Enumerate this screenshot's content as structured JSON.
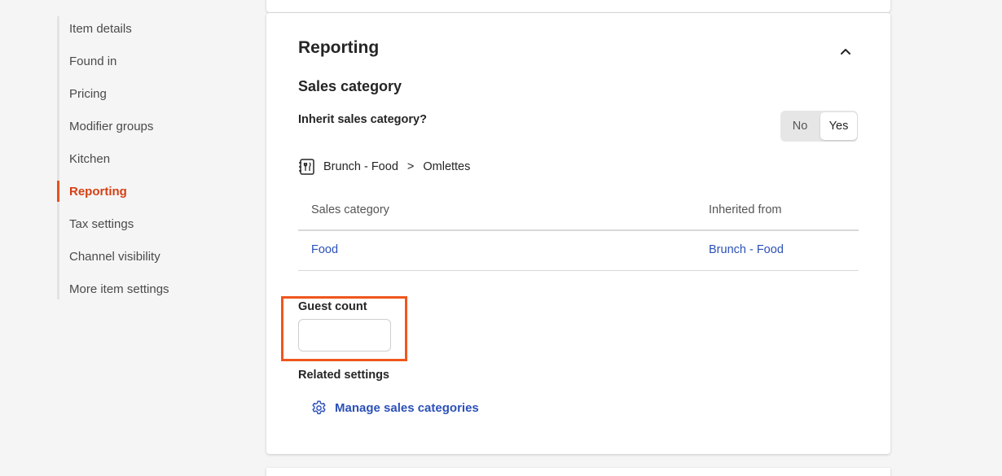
{
  "nav": {
    "items": [
      {
        "label": "Item details"
      },
      {
        "label": "Found in"
      },
      {
        "label": "Pricing"
      },
      {
        "label": "Modifier groups"
      },
      {
        "label": "Kitchen"
      },
      {
        "label": "Reporting",
        "active": true
      },
      {
        "label": "Tax settings"
      },
      {
        "label": "Channel visibility"
      },
      {
        "label": "More item settings"
      }
    ]
  },
  "reporting": {
    "title": "Reporting",
    "section_title": "Sales category",
    "inherit_label": "Inherit sales category?",
    "toggle": {
      "no": "No",
      "yes": "Yes",
      "selected": "Yes"
    },
    "breadcrumb": {
      "parent": "Brunch - Food",
      "separator": ">",
      "child": "Omlettes",
      "icon": "menu-group-icon"
    },
    "table": {
      "headers": [
        "Sales category",
        "Inherited from"
      ],
      "rows": [
        [
          "Food",
          "Brunch - Food"
        ]
      ]
    },
    "guest_count": {
      "label": "Guest count",
      "value": "",
      "placeholder": ""
    },
    "related_settings": "Related settings",
    "manage_link": {
      "label": "Manage sales categories",
      "icon": "gear-icon"
    }
  },
  "colors": {
    "accent": "#e8511d",
    "link": "#2b50b8",
    "highlight": "#f0561d"
  }
}
